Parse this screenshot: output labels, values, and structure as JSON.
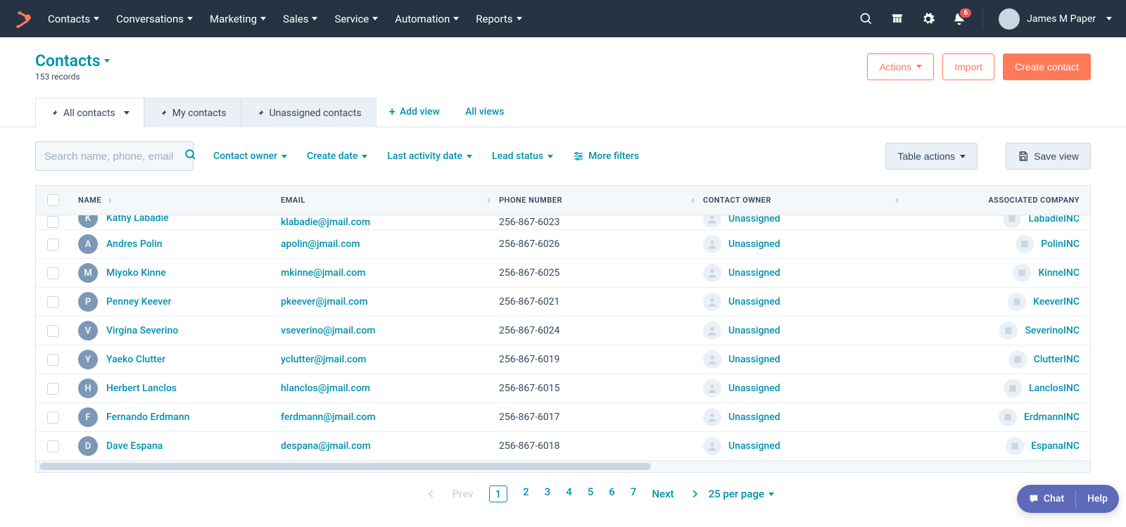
{
  "nav": {
    "items": [
      "Contacts",
      "Conversations",
      "Marketing",
      "Sales",
      "Service",
      "Automation",
      "Reports"
    ],
    "user": "James M Paper",
    "notif_count": "6"
  },
  "page": {
    "title": "Contacts",
    "records": "153 records",
    "actions_label": "Actions",
    "import_label": "Import",
    "create_label": "Create contact"
  },
  "tabs": {
    "items": [
      {
        "label": "All contacts",
        "active": true,
        "dropdown": true
      },
      {
        "label": "My contacts",
        "active": false,
        "dropdown": false
      },
      {
        "label": "Unassigned contacts",
        "active": false,
        "dropdown": false
      }
    ],
    "add_view": "Add view",
    "all_views": "All views"
  },
  "filters": {
    "search_placeholder": "Search name, phone, email",
    "owner": "Contact owner",
    "createdate": "Create date",
    "lastactivity": "Last activity date",
    "leadstatus": "Lead status",
    "more": "More filters",
    "table_actions": "Table actions",
    "save_view": "Save view"
  },
  "table": {
    "headers": {
      "name": "NAME",
      "email": "EMAIL",
      "phone": "PHONE NUMBER",
      "owner": "CONTACT OWNER",
      "company": "ASSOCIATED COMPANY"
    },
    "rows": [
      {
        "initial": "K",
        "name": "Kathy Labadie",
        "email": "klabadie@jmail.com",
        "phone": "256-867-6023",
        "owner": "Unassigned",
        "company": "LabadieINC",
        "partial": true
      },
      {
        "initial": "A",
        "name": "Andres Polin",
        "email": "apolin@jmail.com",
        "phone": "256-867-6026",
        "owner": "Unassigned",
        "company": "PolinINC"
      },
      {
        "initial": "M",
        "name": "Miyoko Kinne",
        "email": "mkinne@jmail.com",
        "phone": "256-867-6025",
        "owner": "Unassigned",
        "company": "KinneINC"
      },
      {
        "initial": "P",
        "name": "Penney Keever",
        "email": "pkeever@jmail.com",
        "phone": "256-867-6021",
        "owner": "Unassigned",
        "company": "KeeverINC"
      },
      {
        "initial": "V",
        "name": "Virgina Severino",
        "email": "vseverino@jmail.com",
        "phone": "256-867-6024",
        "owner": "Unassigned",
        "company": "SeverinoINC"
      },
      {
        "initial": "Y",
        "name": "Yaeko Clutter",
        "email": "yclutter@jmail.com",
        "phone": "256-867-6019",
        "owner": "Unassigned",
        "company": "ClutterINC"
      },
      {
        "initial": "H",
        "name": "Herbert Lanclos",
        "email": "hlanclos@jmail.com",
        "phone": "256-867-6015",
        "owner": "Unassigned",
        "company": "LanclosINC"
      },
      {
        "initial": "F",
        "name": "Fernando Erdmann",
        "email": "ferdmann@jmail.com",
        "phone": "256-867-6017",
        "owner": "Unassigned",
        "company": "ErdmannINC"
      },
      {
        "initial": "D",
        "name": "Dave Espana",
        "email": "despana@jmail.com",
        "phone": "256-867-6018",
        "owner": "Unassigned",
        "company": "EspanaINC"
      }
    ]
  },
  "pagination": {
    "prev": "Prev",
    "pages": [
      "1",
      "2",
      "3",
      "4",
      "5",
      "6",
      "7"
    ],
    "next": "Next",
    "per_page": "25 per page"
  },
  "chat": {
    "chat": "Chat",
    "help": "Help"
  }
}
